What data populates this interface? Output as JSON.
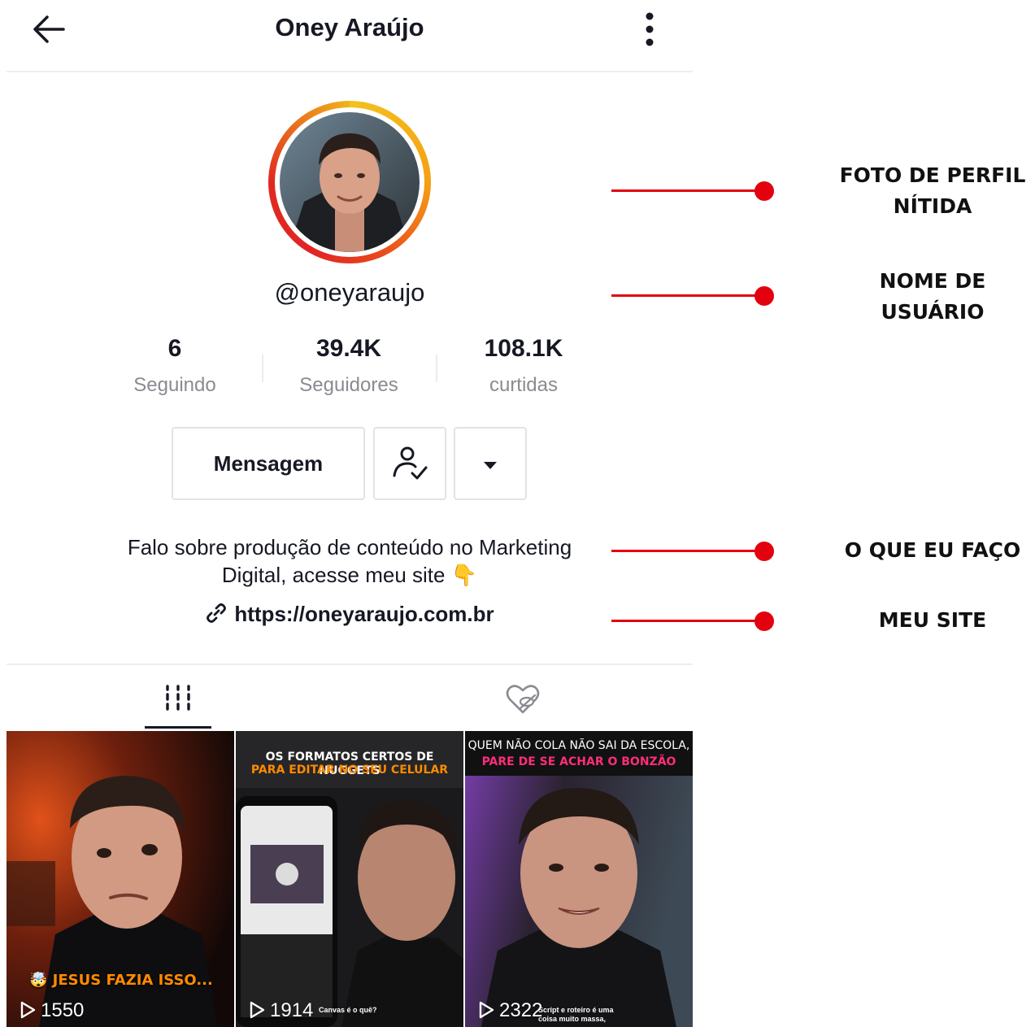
{
  "header": {
    "title": "Oney Araújo"
  },
  "profile": {
    "username": "@oneyaraujo",
    "stats": [
      {
        "value": "6",
        "label": "Seguindo"
      },
      {
        "value": "39.4K",
        "label": "Seguidores"
      },
      {
        "value": "108.1K",
        "label": "curtidas"
      }
    ],
    "message_button": "Mensagem",
    "bio_line1": "Falo sobre produção de conteúdo no Marketing",
    "bio_line2": "Digital, acesse meu site 👇",
    "link": "https://oneyaraujo.com.br"
  },
  "videos": [
    {
      "views": "1550",
      "caption_bottom": "🤯 JESUS FAZIA ISSO..."
    },
    {
      "views": "1914",
      "caption_top_1": "OS FORMATOS CERTOS DE NUGGETS",
      "caption_top_2": "PARA EDITAR NO SEU CELULAR",
      "small_caption": "Canvas é o quê?"
    },
    {
      "views": "2322",
      "caption_top_1": "QUEM NÃO COLA NÃO SAI DA ESCOLA,",
      "caption_top_2": "PARE DE SE ACHAR O BONZÃO",
      "small_caption_1": "Script e roteiro é uma",
      "small_caption_2": "coisa muito massa,"
    }
  ],
  "annotations": [
    {
      "line1": "FOTO DE PERFIL",
      "line2": "NÍTIDA"
    },
    {
      "line1": "NOME DE",
      "line2": "USUÁRIO"
    },
    {
      "line1": "O QUE EU FAÇO"
    },
    {
      "line1": "MEU SITE"
    }
  ],
  "colors": {
    "annotation_red": "#e3000f",
    "text_primary": "#161823",
    "text_secondary": "#8a8b91",
    "orange_caption": "#ff8a00",
    "pink_caption": "#ff2d7a"
  },
  "icons": {
    "back": "arrow-left-icon",
    "menu": "kebab-menu-icon",
    "follow_status": "user-check-icon",
    "more": "caret-down-icon",
    "link": "link-icon",
    "videos_tab": "grid-icon",
    "liked_tab": "hidden-heart-icon",
    "views": "play-icon"
  }
}
